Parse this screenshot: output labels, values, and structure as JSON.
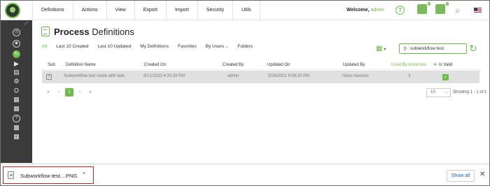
{
  "topbar": {
    "menu": [
      "Definitions",
      "Actions",
      "View",
      "Export",
      "Import",
      "Security",
      "Utils"
    ],
    "welcome_label": "Welcome,",
    "username": "admin",
    "notification_badge_1": "1",
    "notification_badge_2": "1"
  },
  "page": {
    "title_bold": "Process",
    "title_rest": "Definitions"
  },
  "tabs": [
    {
      "label": "All",
      "active": true
    },
    {
      "label": "Last 10 Created"
    },
    {
      "label": "Last 10 Updated"
    },
    {
      "label": "My Definitions"
    },
    {
      "label": "Favorites"
    },
    {
      "label": "By Users"
    },
    {
      "label": "Folders"
    }
  ],
  "search": {
    "value": "subworkflow test"
  },
  "table": {
    "headers": {
      "sub": "Sub",
      "name": "Definition Name",
      "created_on": "Created On",
      "created_by": "Created By",
      "updated_on": "Updated On",
      "updated_by": "Updated By",
      "used_by": "Used By Instances",
      "is_valid": "Is Valid"
    },
    "rows": [
      {
        "name": "Subworkflow test mode with task",
        "created_on": "8/12/2020 4:30:33 PM",
        "created_by": "admin",
        "updated_on": "5/26/2021 9:06:20 PM",
        "updated_by": "Hans Hanlson",
        "used_by": "3"
      }
    ]
  },
  "pagination": {
    "first": "«",
    "prev": "‹",
    "current": "1",
    "next": "›",
    "last": "»",
    "page_size": "10",
    "showing": "Showing 1 - 1 of 1"
  },
  "download_bar": {
    "file_name": "Subworkflow test....PNG",
    "show_all": "Show all"
  },
  "colors": {
    "accent": "#6dbb4a",
    "sidebar": "#3b3b3b",
    "row_highlight": "#e0e0e0"
  }
}
